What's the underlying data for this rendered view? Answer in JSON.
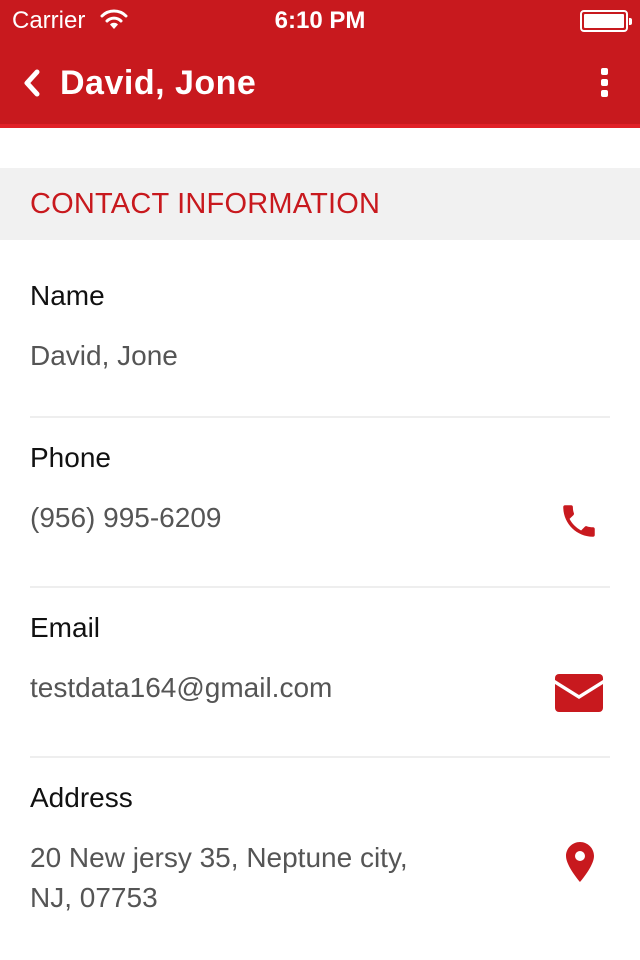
{
  "status_bar": {
    "carrier": "Carrier",
    "time": "6:10 PM",
    "wifi_icon": "wifi-icon",
    "battery_icon": "battery-icon"
  },
  "nav": {
    "title": "David, Jone",
    "back_icon": "chevron-left-icon",
    "menu_icon": "more-vertical-icon"
  },
  "section": {
    "title": "CONTACT INFORMATION"
  },
  "fields": {
    "name": {
      "label": "Name",
      "value": "David, Jone"
    },
    "phone": {
      "label": "Phone",
      "value": "(956) 995-6209",
      "icon": "phone-icon"
    },
    "email": {
      "label": "Email",
      "value": "testdata164@gmail.com",
      "icon": "mail-icon"
    },
    "address": {
      "label": "Address",
      "line1": "20 New jersy 35, Neptune city,",
      "line2": "NJ, 07753",
      "icon": "map-pin-icon"
    }
  },
  "colors": {
    "brand_red": "#c8191e",
    "section_bg": "#f1f1f1",
    "value_text": "#555555"
  }
}
